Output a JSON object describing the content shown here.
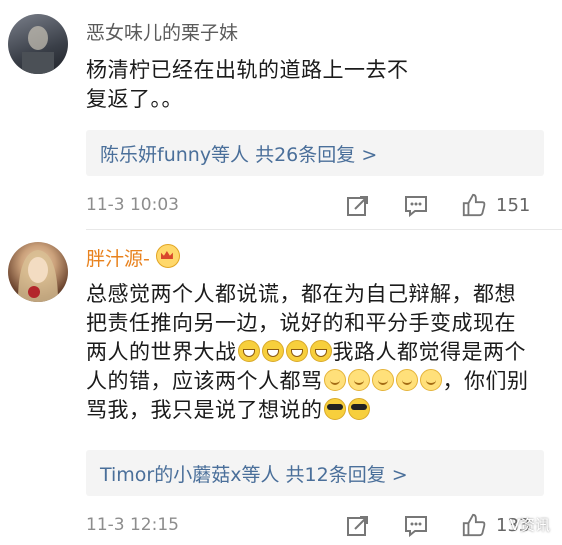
{
  "comments": [
    {
      "username": "恶女味儿的栗子妹",
      "text": "杨清柠已经在出轨的道路上一去不复返了。。",
      "replies": "陈乐妍funny等人 共26条回复 >",
      "time": "11-3 10:03",
      "likes": "151"
    },
    {
      "username": "胖汁源-",
      "text_parts": [
        "总感觉两个人都说谎，都在为自己辩解，都想把责任推向另一边，说好的和平分手变成现在两人的世界大战",
        "我路人都觉得是两个人的错，应该两个人都骂",
        "，你们别骂我，我只是说了想说的"
      ],
      "replies": "Timor的小蘑菇x等人 共12条回复 >",
      "time": "11-3 12:15",
      "likes": "133"
    }
  ],
  "watermark": "V资讯",
  "icons": [
    "share-icon",
    "comment-icon",
    "like-icon",
    "crown-icon"
  ]
}
